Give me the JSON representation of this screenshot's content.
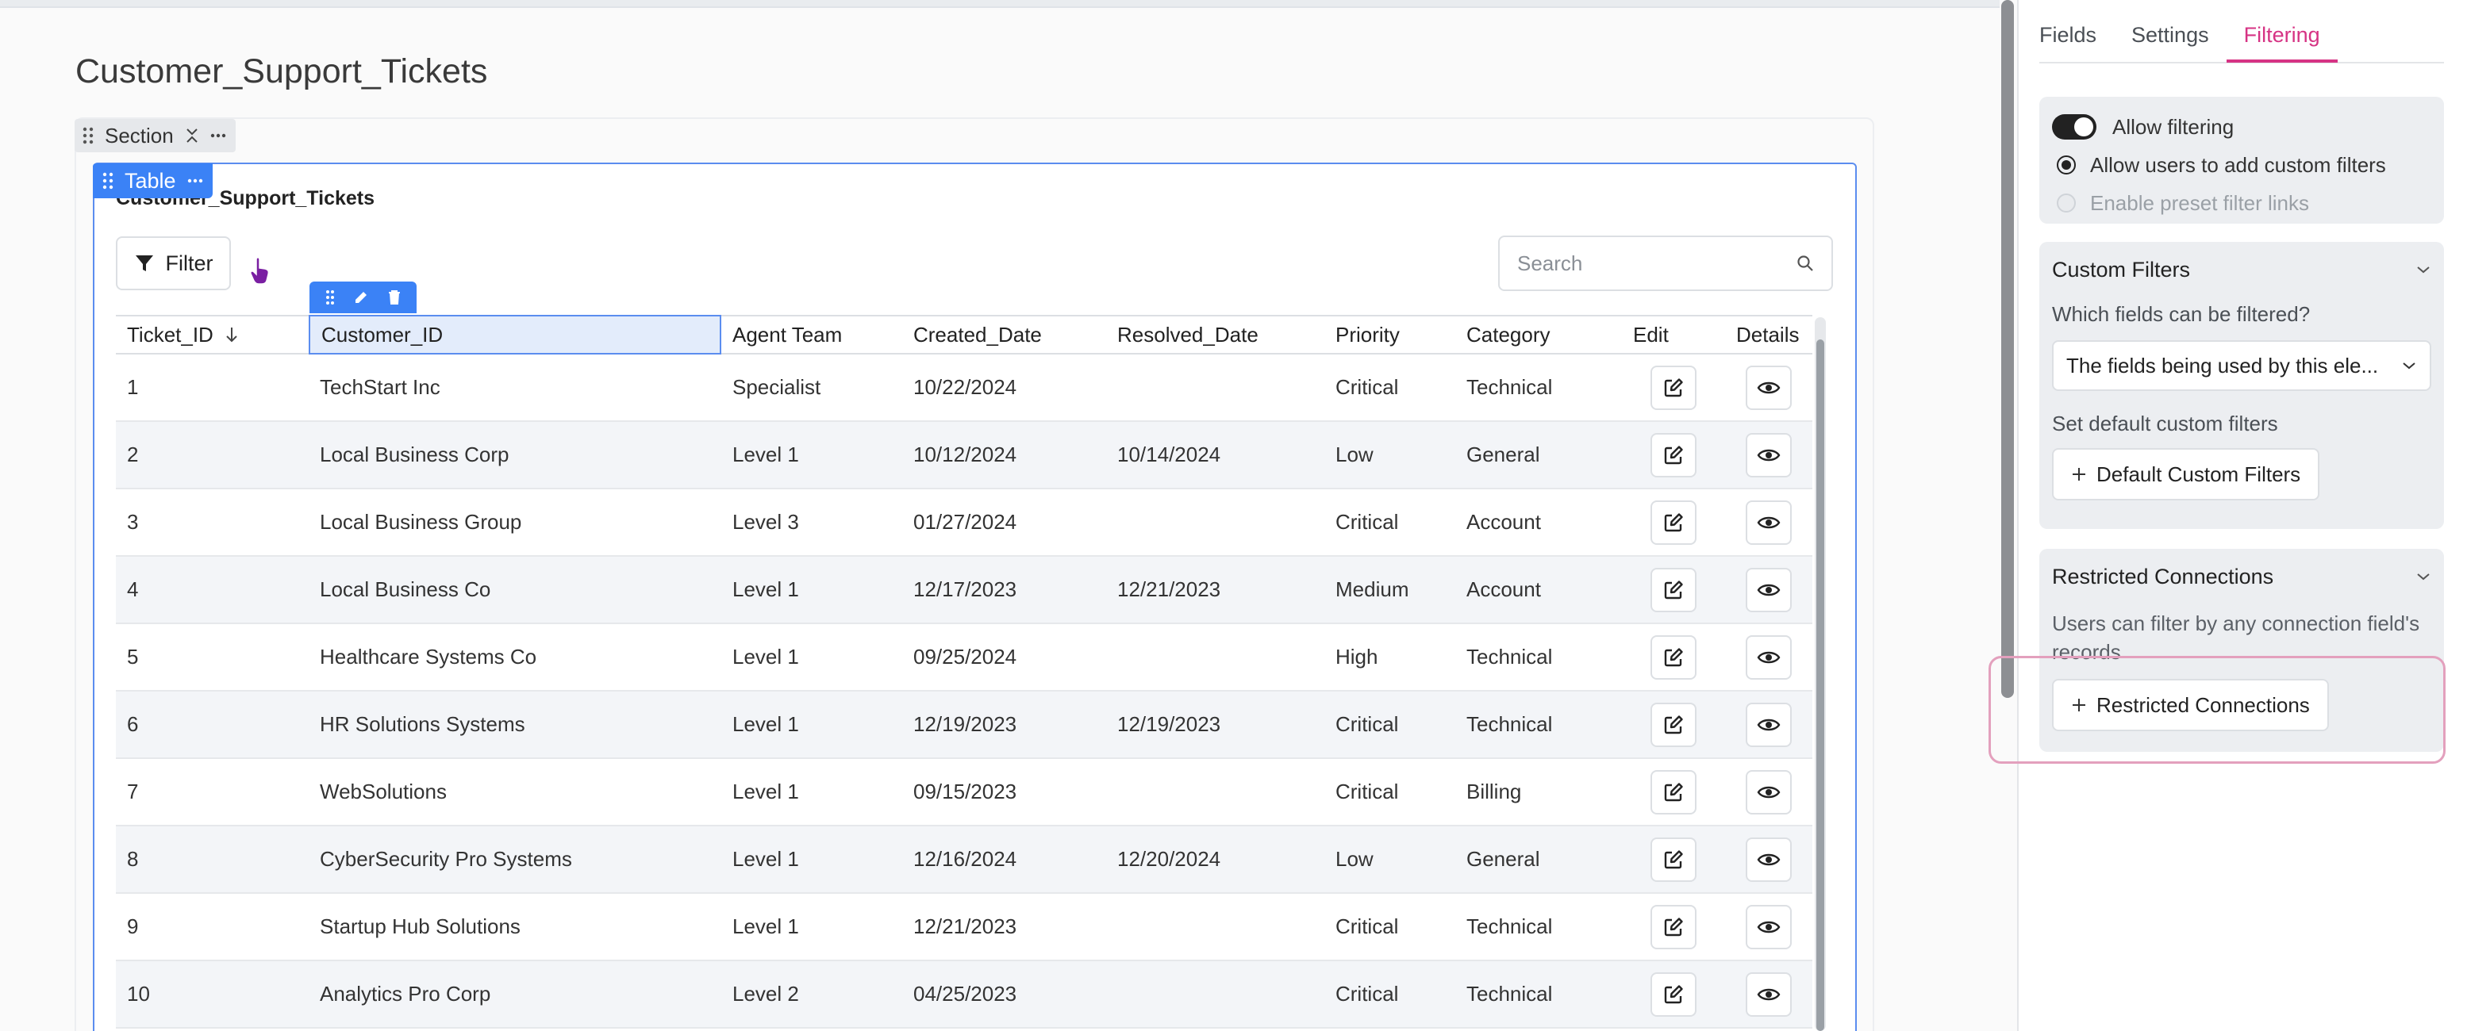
{
  "page": {
    "title": "Customer_Support_Tickets"
  },
  "section": {
    "label": "Section"
  },
  "table_block": {
    "tag_label": "Table",
    "heading": "Customer_Support_Tickets",
    "filter_label": "Filter",
    "search_placeholder": "Search"
  },
  "table": {
    "columns": [
      "Ticket_ID",
      "Customer_ID",
      "Agent Team",
      "Created_Date",
      "Resolved_Date",
      "Priority",
      "Category",
      "Edit",
      "Details"
    ],
    "rows": [
      [
        "1",
        "TechStart Inc",
        "Specialist",
        "10/22/2024",
        "",
        "Critical",
        "Technical"
      ],
      [
        "2",
        "Local Business Corp",
        "Level 1",
        "10/12/2024",
        "10/14/2024",
        "Low",
        "General"
      ],
      [
        "3",
        "Local Business Group",
        "Level 3",
        "01/27/2024",
        "",
        "Critical",
        "Account"
      ],
      [
        "4",
        "Local Business Co",
        "Level 1",
        "12/17/2023",
        "12/21/2023",
        "Medium",
        "Account"
      ],
      [
        "5",
        "Healthcare Systems Co",
        "Level 1",
        "09/25/2024",
        "",
        "High",
        "Technical"
      ],
      [
        "6",
        "HR Solutions Systems",
        "Level 1",
        "12/19/2023",
        "12/19/2023",
        "Critical",
        "Technical"
      ],
      [
        "7",
        "WebSolutions",
        "Level 1",
        "09/15/2023",
        "",
        "Critical",
        "Billing"
      ],
      [
        "8",
        "CyberSecurity Pro Systems",
        "Level 1",
        "12/16/2024",
        "12/20/2024",
        "Low",
        "General"
      ],
      [
        "9",
        "Startup Hub Solutions",
        "Level 1",
        "12/21/2023",
        "",
        "Critical",
        "Technical"
      ],
      [
        "10",
        "Analytics Pro Corp",
        "Level 2",
        "04/25/2023",
        "",
        "Critical",
        "Technical"
      ]
    ]
  },
  "panel": {
    "tabs": [
      "Fields",
      "Settings",
      "Filtering"
    ],
    "active_tab": "Filtering",
    "options": {
      "allow_filtering": "Allow filtering",
      "allow_custom": "Allow users to add custom filters",
      "preset_links": "Enable preset filter links"
    },
    "custom_filters": {
      "title": "Custom Filters",
      "question": "Which fields can be filtered?",
      "select_value": "The fields being used by this ele...",
      "default_label": "Set default custom filters",
      "default_button": "Default Custom Filters"
    },
    "restricted": {
      "title": "Restricted Connections",
      "description": "Users can filter by any connection field's records",
      "button": "Restricted Connections"
    }
  },
  "colors": {
    "accent": "#d63384",
    "selection": "#3b82f6"
  },
  "icons": [
    "drag-handle-icon",
    "collapse-icon",
    "more-icon",
    "filter-icon",
    "search-icon",
    "sort-down-icon",
    "pencil-icon",
    "trash-icon",
    "edit-icon",
    "eye-icon",
    "chevron-down-icon",
    "plus-icon",
    "cursor-icon"
  ]
}
